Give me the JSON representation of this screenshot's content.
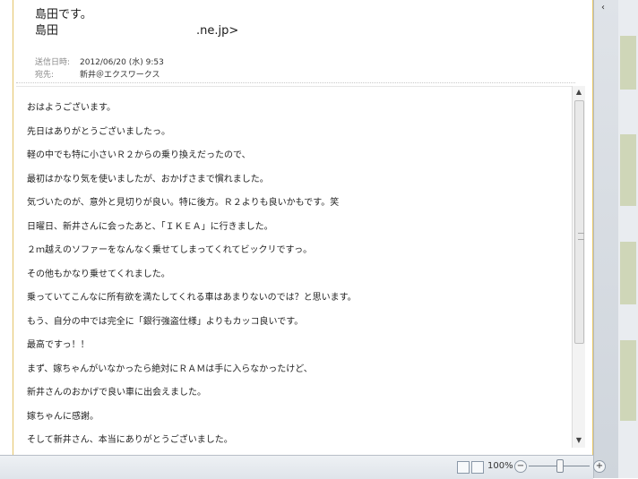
{
  "header": {
    "subject_line": "島田です。",
    "sender_name": "島田",
    "sender_addr_suffix": ".ne.jp>",
    "sent_label": "送信日時:",
    "sent_value": "2012/06/20 (水) 9:53",
    "to_label": "宛先:",
    "to_value": "新井＠エクスワークス"
  },
  "body_lines": [
    "おはようございます。",
    "先日はありがとうございましたっ。",
    "軽の中でも特に小さいＲ２からの乗り換えだったので、",
    "最初はかなり気を使いましたが、おかげさまで慣れました。",
    "気づいたのが、意外と見切りが良い。特に後方。Ｒ２よりも良いかもです。笑",
    "日曜日、新井さんに会ったあと、「ＩＫＥＡ」に行きました。",
    "２ｍ越えのソファーをなんなく乗せてしまってくれてビックリですっ。",
    "その他もかなり乗せてくれました。",
    "乗っていてこんなに所有欲を満たしてくれる車はあまりないのでは？と思います。",
    "もう、自分の中では完全に「銀行強盗仕様」よりもカッコ良いです。",
    "最高ですっ！！",
    "まず、嫁ちゃんがいなかったら絶対にＲＡＭは手に入らなかったけど、",
    "新井さんのおかげで良い車に出会えました。",
    "嫁ちゃんに感謝。",
    "そして新井さん、本当にありがとうございました。"
  ],
  "statusbar": {
    "zoom_label": "100%",
    "zoom_percent": 100
  },
  "icons": {
    "collapse": "chevron-left-icon",
    "scroll_up": "scroll-up-arrow-icon",
    "scroll_down": "scroll-down-arrow-icon",
    "zoom_out": "minus-icon",
    "zoom_in": "plus-icon"
  }
}
